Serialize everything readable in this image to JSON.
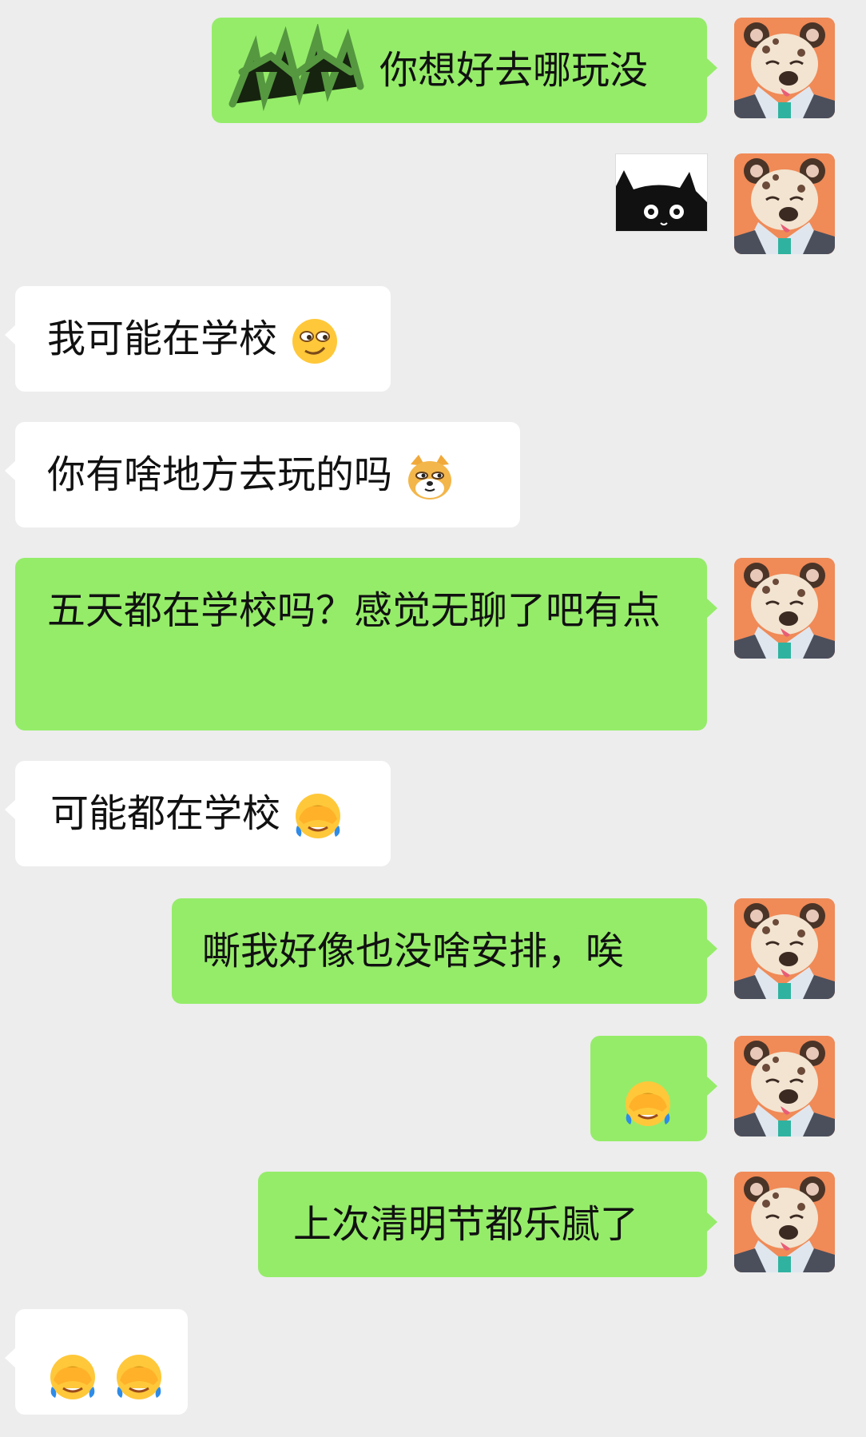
{
  "messages": [
    {
      "side": "me",
      "text": "你想好去哪玩没",
      "redacted": true,
      "emoji": []
    },
    {
      "side": "me",
      "type": "sticker",
      "sticker": "black-cat-sticker"
    },
    {
      "side": "other",
      "text": "我可能在学校",
      "emoji": [
        "smirk-emoji"
      ]
    },
    {
      "side": "other",
      "text": "你有啥地方去玩的吗",
      "emoji": [
        "doge-emoji"
      ]
    },
    {
      "side": "me",
      "text": "五天都在学校吗？感觉无聊了吧有点",
      "emoji": []
    },
    {
      "side": "other",
      "text": "可能都在学校",
      "emoji": [
        "facepalm-cry-emoji"
      ]
    },
    {
      "side": "me",
      "text": "嘶我好像也没啥安排，唉",
      "emoji": []
    },
    {
      "side": "me",
      "text": "",
      "emoji": [
        "facepalm-cry-emoji"
      ]
    },
    {
      "side": "me",
      "text": "上次清明节都乐腻了",
      "emoji": []
    },
    {
      "side": "other",
      "text": "",
      "emoji": [
        "facepalm-cry-emoji",
        "facepalm-cry-emoji"
      ]
    }
  ],
  "colors": {
    "background": "#ededed",
    "my_bubble": "#95ec69",
    "other_bubble": "#ffffff",
    "avatar_bg": "#f08a57"
  },
  "icons": {
    "avatar": "hyena-avatar-icon"
  }
}
